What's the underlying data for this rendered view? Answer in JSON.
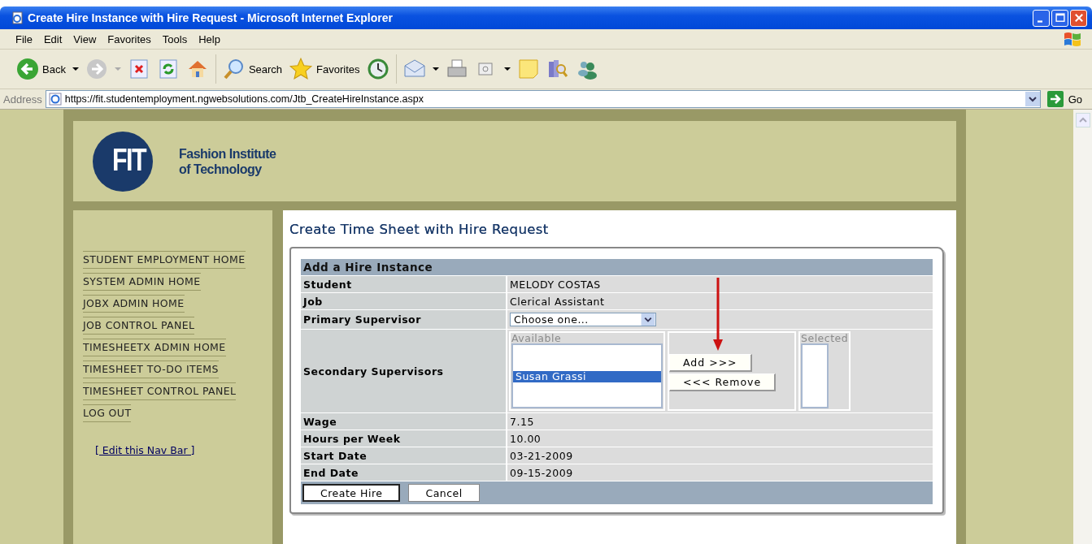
{
  "window": {
    "title": "Create Hire Instance with Hire Request - Microsoft Internet Explorer"
  },
  "menu": [
    "File",
    "Edit",
    "View",
    "Favorites",
    "Tools",
    "Help"
  ],
  "toolbar": {
    "back": "Back",
    "search": "Search",
    "favorites": "Favorites"
  },
  "address": {
    "label": "Address",
    "url": "https://fit.studentemployment.ngwebsolutions.com/Jtb_CreateHireInstance.aspx",
    "go": "Go"
  },
  "logo": {
    "mark": "FIT",
    "name_line1": "Fashion Institute",
    "name_line2": "of Technology"
  },
  "nav": {
    "items": [
      "STUDENT EMPLOYMENT HOME",
      "SYSTEM ADMIN HOME",
      "JOBX ADMIN HOME",
      "JOB CONTROL PANEL",
      "TIMESHEETX ADMIN HOME",
      "TIMESHEET TO-DO ITEMS",
      "TIMESHEET CONTROL PANEL",
      "LOG OUT"
    ],
    "edit_link": "[ Edit this Nav Bar ]"
  },
  "page_title": "Create Time Sheet with Hire Request",
  "form": {
    "heading": "Add a Hire Instance",
    "rows": [
      {
        "kind": "text",
        "label": "Student",
        "value": "MELODY COSTAS"
      },
      {
        "kind": "text",
        "label": "Job",
        "value": "Clerical Assistant"
      },
      {
        "kind": "select",
        "label": "Primary Supervisor",
        "value": "Choose one..."
      },
      {
        "kind": "picker",
        "label": "Secondary Supervisors",
        "available_label": "Available",
        "available": [
          {
            "name": "Susan Grassi",
            "selected": true
          }
        ],
        "add": "Add >>>",
        "remove": "<<< Remove",
        "selected_label": "Selected"
      },
      {
        "kind": "text",
        "label": "Wage",
        "value": "7.15"
      },
      {
        "kind": "text",
        "label": "Hours per Week",
        "value": "10.00"
      },
      {
        "kind": "text",
        "label": "Start Date",
        "value": "03-21-2009"
      },
      {
        "kind": "text",
        "label": "End Date",
        "value": "09-15-2009"
      }
    ],
    "buttons": [
      "Create Hire",
      "Cancel"
    ]
  }
}
